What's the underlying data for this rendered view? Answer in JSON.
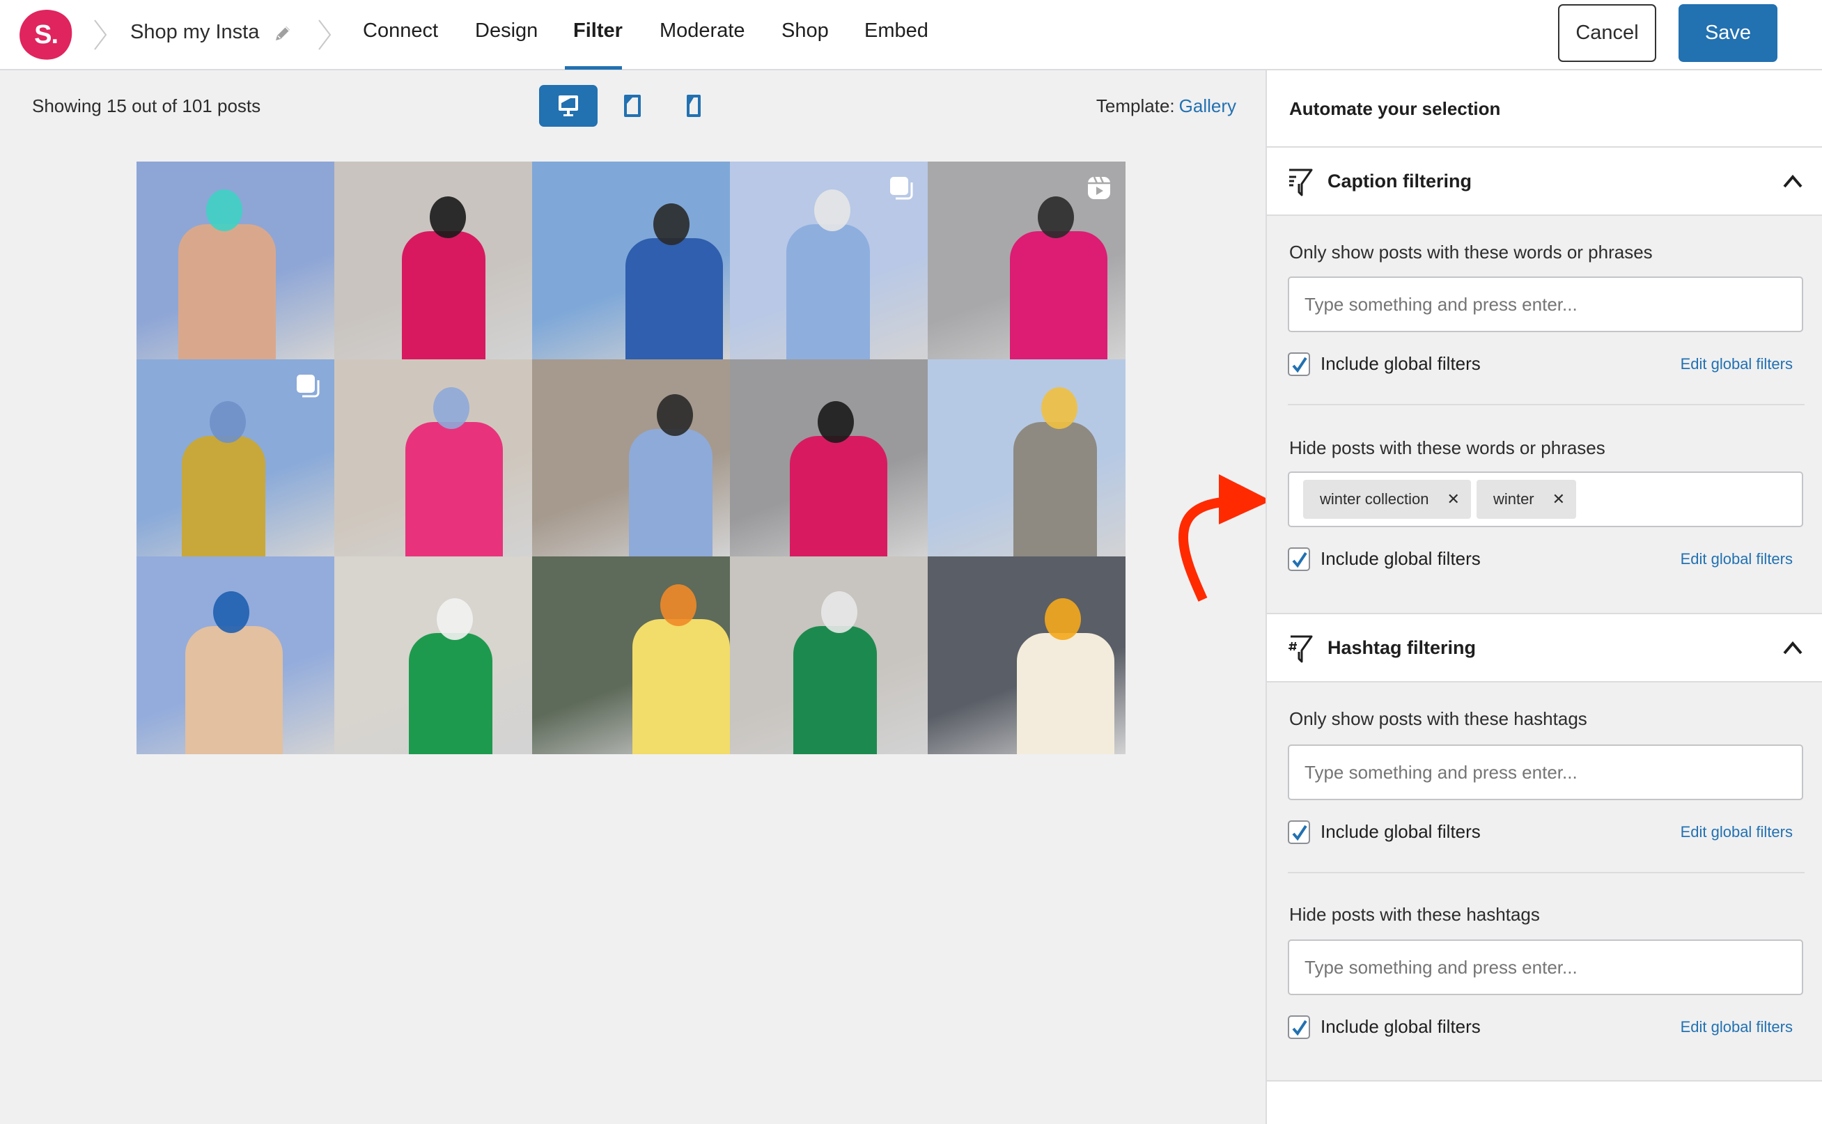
{
  "header": {
    "logo_text": "S.",
    "feed_name": "Shop my Insta",
    "nav": [
      {
        "label": "Connect",
        "active": false
      },
      {
        "label": "Design",
        "active": false
      },
      {
        "label": "Filter",
        "active": true
      },
      {
        "label": "Moderate",
        "active": false
      },
      {
        "label": "Shop",
        "active": false
      },
      {
        "label": "Embed",
        "active": false
      }
    ],
    "cancel_label": "Cancel",
    "save_label": "Save"
  },
  "toolbar": {
    "showing_text": "Showing 15 out of 101 posts",
    "devices": [
      {
        "name": "desktop-icon",
        "active": true
      },
      {
        "name": "tablet-icon",
        "active": false
      },
      {
        "name": "phone-icon",
        "active": false
      }
    ],
    "template_label": "Template:",
    "template_value": "Gallery"
  },
  "grid": {
    "posts": [
      {
        "bg": "#8ea6d6",
        "fg": "#d9a88c",
        "accent": "#3fd1c4",
        "overlay": ""
      },
      {
        "bg": "#c9c4bf",
        "fg": "#d8195f",
        "accent": "#1b1b1b",
        "overlay": ""
      },
      {
        "bg": "#7fa8d8",
        "fg": "#2f5fae",
        "accent": "#2a2a2a",
        "overlay": ""
      },
      {
        "bg": "#b8c8e6",
        "fg": "#8eaede",
        "accent": "#e6e6e6",
        "overlay": "carousel-icon"
      },
      {
        "bg": "#a8a8aa",
        "fg": "#dc1d73",
        "accent": "#2a2a2a",
        "overlay": "reel-icon"
      },
      {
        "bg": "#8aaad9",
        "fg": "#c8a83a",
        "accent": "#6f90c8",
        "overlay": "carousel-icon"
      },
      {
        "bg": "#cfc7bd",
        "fg": "#e8337c",
        "accent": "#8ea8d8",
        "overlay": ""
      },
      {
        "bg": "#a69a8e",
        "fg": "#8eaad8",
        "accent": "#2a2a2a",
        "overlay": ""
      },
      {
        "bg": "#9a9a9c",
        "fg": "#d81b60",
        "accent": "#1b1b1b",
        "overlay": ""
      },
      {
        "bg": "#b6c9e4",
        "fg": "#8e8a82",
        "accent": "#f0c040",
        "overlay": ""
      },
      {
        "bg": "#93acdc",
        "fg": "#e2c0a0",
        "accent": "#1f5fb0",
        "overlay": ""
      },
      {
        "bg": "#d8d4ce",
        "fg": "#1e9a4e",
        "accent": "#f2f2f2",
        "overlay": ""
      },
      {
        "bg": "#5e6a5a",
        "fg": "#f2dc6a",
        "accent": "#f08a28",
        "overlay": ""
      },
      {
        "bg": "#c8c4bf",
        "fg": "#1c8a4e",
        "accent": "#e8e8e8",
        "overlay": ""
      },
      {
        "bg": "#5a5e66",
        "fg": "#f3ecdc",
        "accent": "#f4a81c",
        "overlay": ""
      }
    ]
  },
  "sidebar": {
    "title": "Automate your selection",
    "sections": [
      {
        "title": "Caption filtering",
        "icon": "caption-filter-icon",
        "expanded": true,
        "groups": [
          {
            "label": "Only show posts with these words or phrases",
            "placeholder": "Type something and press enter...",
            "tags": [],
            "include_global": true,
            "include_label": "Include global filters",
            "edit_link": "Edit global filters"
          },
          {
            "label": "Hide posts with these words or phrases",
            "placeholder": "",
            "tags": [
              "winter collection",
              "winter"
            ],
            "include_global": true,
            "include_label": "Include global filters",
            "edit_link": "Edit global filters"
          }
        ]
      },
      {
        "title": "Hashtag filtering",
        "icon": "hashtag-filter-icon",
        "expanded": true,
        "groups": [
          {
            "label": "Only show posts with these hashtags",
            "placeholder": "Type something and press enter...",
            "tags": [],
            "include_global": true,
            "include_label": "Include global filters",
            "edit_link": "Edit global filters"
          },
          {
            "label": "Hide posts with these hashtags",
            "placeholder": "Type something and press enter...",
            "tags": [],
            "include_global": true,
            "include_label": "Include global filters",
            "edit_link": "Edit global filters"
          }
        ]
      }
    ]
  },
  "colors": {
    "brand": "#e0245e",
    "accent": "#2271b1",
    "annotation_arrow": "#ff2a00"
  }
}
